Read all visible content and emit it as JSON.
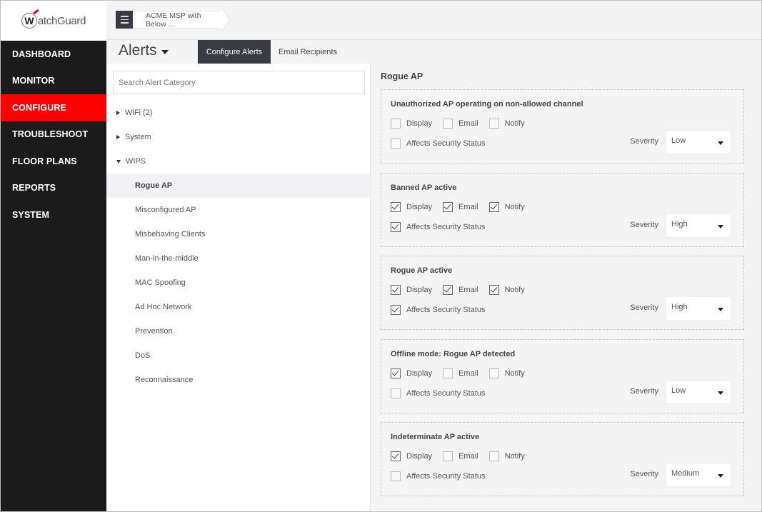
{
  "brand": {
    "logo_text": "atchGuard",
    "logo_initial": "W"
  },
  "sidebar": {
    "items": [
      {
        "label": "DASHBOARD",
        "active": false
      },
      {
        "label": "MONITOR",
        "active": false
      },
      {
        "label": "CONFIGURE",
        "active": true
      },
      {
        "label": "TROUBLESHOOT",
        "active": false
      },
      {
        "label": "FLOOR PLANS",
        "active": false
      },
      {
        "label": "REPORTS",
        "active": false
      },
      {
        "label": "SYSTEM",
        "active": false
      }
    ]
  },
  "topbar": {
    "menu_icon": "hamburger-icon",
    "breadcrumb": "ACME MSP with Below ..."
  },
  "header": {
    "title": "Alerts",
    "tabs": [
      {
        "label": "Configure Alerts",
        "active": true
      },
      {
        "label": "Email Recipients",
        "active": false
      }
    ]
  },
  "list": {
    "search_placeholder": "Search Alert Category",
    "categories": [
      {
        "label": "WiFi (2)",
        "expanded": false
      },
      {
        "label": "System",
        "expanded": false
      },
      {
        "label": "WIPS",
        "expanded": true
      }
    ],
    "children": [
      {
        "label": "Rogue AP",
        "selected": true
      },
      {
        "label": "Misconfigured AP",
        "selected": false
      },
      {
        "label": "Misbehaving Clients",
        "selected": false
      },
      {
        "label": "Man-in-the-middle",
        "selected": false
      },
      {
        "label": "MAC Spoofing",
        "selected": false
      },
      {
        "label": "Ad Hoc Network",
        "selected": false
      },
      {
        "label": "Prevention",
        "selected": false
      },
      {
        "label": "DoS",
        "selected": false
      },
      {
        "label": "Reconnaissance",
        "selected": false
      }
    ]
  },
  "detail": {
    "title": "Rogue AP",
    "labels": {
      "display": "Display",
      "email": "Email",
      "notify": "Notify",
      "affects": "Affects Security Status",
      "severity": "Severity"
    },
    "alerts": [
      {
        "name": "Unauthorized AP operating on non-allowed channel",
        "display": false,
        "email": false,
        "notify": false,
        "affects": false,
        "severity": "Low"
      },
      {
        "name": "Banned AP active",
        "display": true,
        "email": true,
        "notify": true,
        "affects": true,
        "severity": "High"
      },
      {
        "name": "Rogue AP active",
        "display": true,
        "email": true,
        "notify": true,
        "affects": true,
        "severity": "High"
      },
      {
        "name": "Offline mode: Rogue AP detected",
        "display": true,
        "email": false,
        "notify": false,
        "affects": false,
        "severity": "Low"
      },
      {
        "name": "Indeterminate AP active",
        "display": true,
        "email": false,
        "notify": false,
        "affects": false,
        "severity": "Medium"
      }
    ]
  },
  "colors": {
    "accent_red": "#ff0000",
    "sidebar_bg": "#1b1b1b",
    "tab_active_bg": "#3a3a44"
  }
}
